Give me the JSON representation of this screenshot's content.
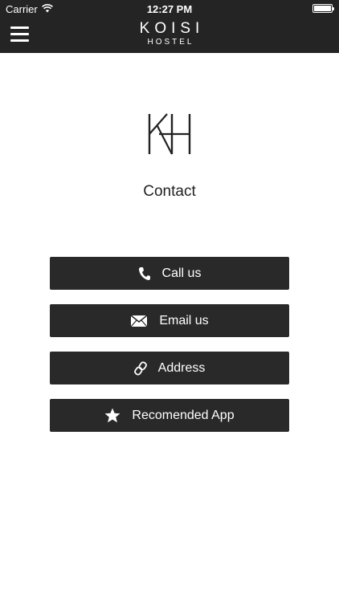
{
  "status_bar": {
    "carrier": "Carrier",
    "time": "12:27 PM"
  },
  "header": {
    "brand_name": "KOISI",
    "brand_sub": "HOSTEL"
  },
  "page": {
    "title": "Contact"
  },
  "buttons": {
    "call": "Call us",
    "email": "Email us",
    "address": "Address",
    "app": "Recomended App"
  },
  "colors": {
    "bar": "#252424",
    "button": "#2a2929",
    "text": "#222222"
  },
  "icons": {
    "menu": "hamburger-icon",
    "call": "phone-icon",
    "email": "envelope-icon",
    "address": "link-icon",
    "app": "star-icon"
  }
}
